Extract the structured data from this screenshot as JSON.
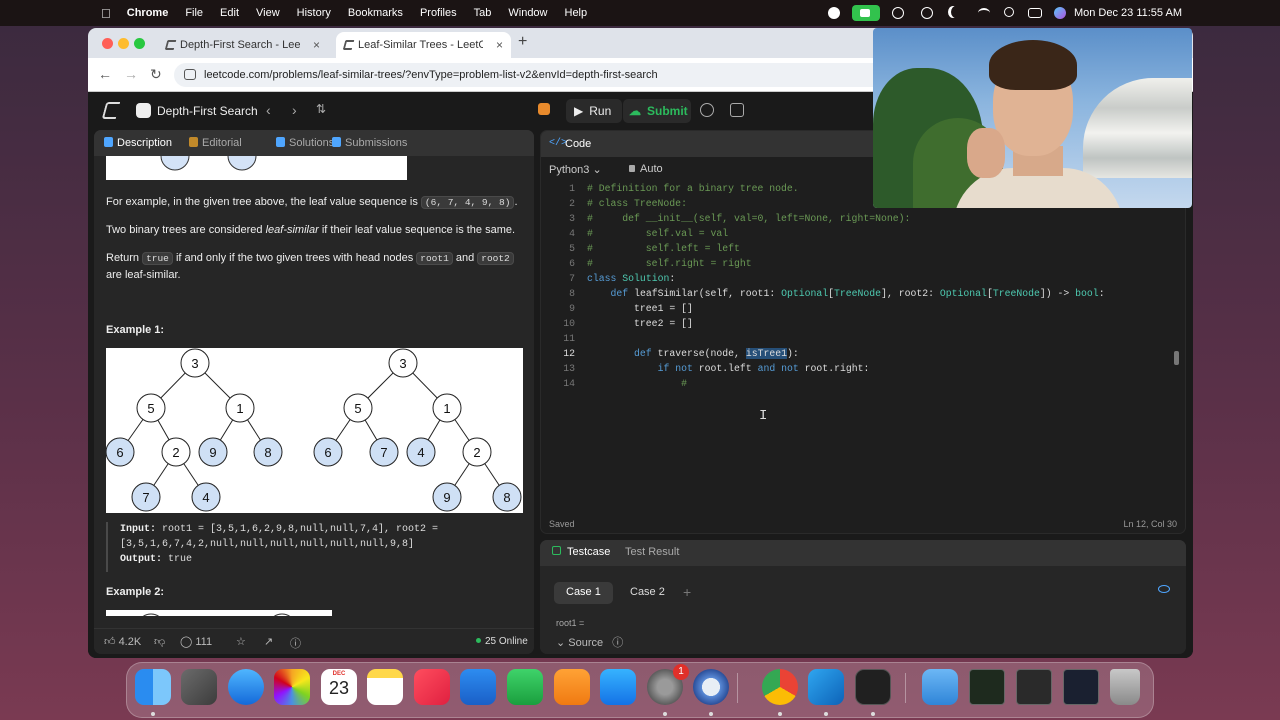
{
  "menubar": {
    "app": "Chrome",
    "items": [
      "File",
      "Edit",
      "View",
      "History",
      "Bookmarks",
      "Profiles",
      "Tab",
      "Window",
      "Help"
    ],
    "clock": "Mon Dec 23  11:55 AM"
  },
  "browser": {
    "tabs": [
      {
        "label": "Depth-First Search - LeetCode",
        "close": "×"
      },
      {
        "label": "Leaf-Similar Trees - LeetCode",
        "close": "×"
      }
    ],
    "new_tab": "+",
    "url": "leetcode.com/problems/leaf-similar-trees/?envType=problem-list-v2&envId=depth-first-search"
  },
  "leetcode": {
    "problem_list": "Depth-First Search",
    "run": "Run",
    "submit": "Submit",
    "left_tabs": [
      "Description",
      "Editorial",
      "Solutions",
      "Submissions"
    ],
    "desc": {
      "p1_before": "For example, in the given tree above, the leaf value sequence is ",
      "p1_code": "(6, 7, 4, 9, 8)",
      "p1_after": ".",
      "p2_before": "Two binary trees are considered ",
      "p2_em": "leaf-similar",
      "p2_after": " if their leaf value sequence is the same.",
      "p3_a": "Return ",
      "p3_code1": "true",
      "p3_b": " if and only if the two given trees with head nodes ",
      "p3_code2": "root1",
      "p3_c": " and ",
      "p3_code3": "root2",
      "p3_d": " are leaf-similar.",
      "example1": "Example 1:",
      "input_label": "Input:",
      "input_value": " root1 = [3,5,1,6,2,9,8,null,null,7,4], root2 = [3,5,1,6,7,4,2,null,null,null,null,null,null,9,8]",
      "output_label": "Output:",
      "output_value": " true",
      "example2": "Example 2:"
    },
    "tree1": {
      "nodes": [
        {
          "v": "3",
          "leaf": false
        },
        {
          "v": "5",
          "leaf": false
        },
        {
          "v": "1",
          "leaf": false
        },
        {
          "v": "6",
          "leaf": true
        },
        {
          "v": "2",
          "leaf": false
        },
        {
          "v": "9",
          "leaf": true
        },
        {
          "v": "8",
          "leaf": true
        },
        {
          "v": "7",
          "leaf": true
        },
        {
          "v": "4",
          "leaf": true
        }
      ]
    },
    "tree2": {
      "nodes": [
        {
          "v": "3",
          "leaf": false
        },
        {
          "v": "5",
          "leaf": false
        },
        {
          "v": "1",
          "leaf": false
        },
        {
          "v": "6",
          "leaf": true
        },
        {
          "v": "7",
          "leaf": true
        },
        {
          "v": "4",
          "leaf": true
        },
        {
          "v": "2",
          "leaf": false
        },
        {
          "v": "9",
          "leaf": true
        },
        {
          "v": "8",
          "leaf": true
        }
      ]
    },
    "footer": {
      "likes": "4.2K",
      "comments": "111",
      "online": "25 Online"
    },
    "code_panel": {
      "title": "Code",
      "language": "Python3",
      "mode": "Auto",
      "status": "Saved",
      "position": "Ln 12, Col 30",
      "lines": [
        "# Definition for a binary tree node.",
        "# class TreeNode:",
        "#     def __init__(self, val=0, left=None, right=None):",
        "#         self.val = val",
        "#         self.left = left",
        "#         self.right = right",
        "class Solution:",
        "    def leafSimilar(self, root1: Optional[TreeNode], root2: Optional[TreeNode]) -> bool:",
        "        tree1 = []",
        "        tree2 = []",
        "",
        "        def traverse(node, isTree1):",
        "            if not root.left and not root.right:",
        "                #"
      ]
    },
    "test_panel": {
      "tab_testcase": "Testcase",
      "tab_result": "Test Result",
      "cases": [
        "Case 1",
        "Case 2"
      ],
      "add": "+",
      "root1_label": "root1 =",
      "source": "Source"
    }
  },
  "dock": {
    "calendar_month": "DEC",
    "calendar_day": "23",
    "settings_badge": "1"
  }
}
